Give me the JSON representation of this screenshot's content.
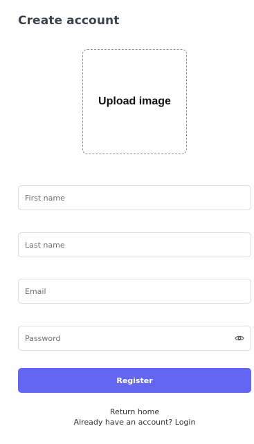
{
  "page": {
    "title": "Create account"
  },
  "upload": {
    "label": "Upload image"
  },
  "form": {
    "first_name_placeholder": "First name",
    "first_name_value": "",
    "last_name_placeholder": "Last name",
    "last_name_value": "",
    "email_placeholder": "Email",
    "email_value": "",
    "password_placeholder": "Password",
    "password_value": "",
    "password_toggle_icon": "eye-icon",
    "register_label": "Register"
  },
  "footer": {
    "return_home": "Return home",
    "login_prompt": "Already have an account? Login"
  },
  "colors": {
    "accent": "#6366f1",
    "title": "#3d4248",
    "input_border": "#d9dce1",
    "upload_border": "#8e8e8e"
  }
}
